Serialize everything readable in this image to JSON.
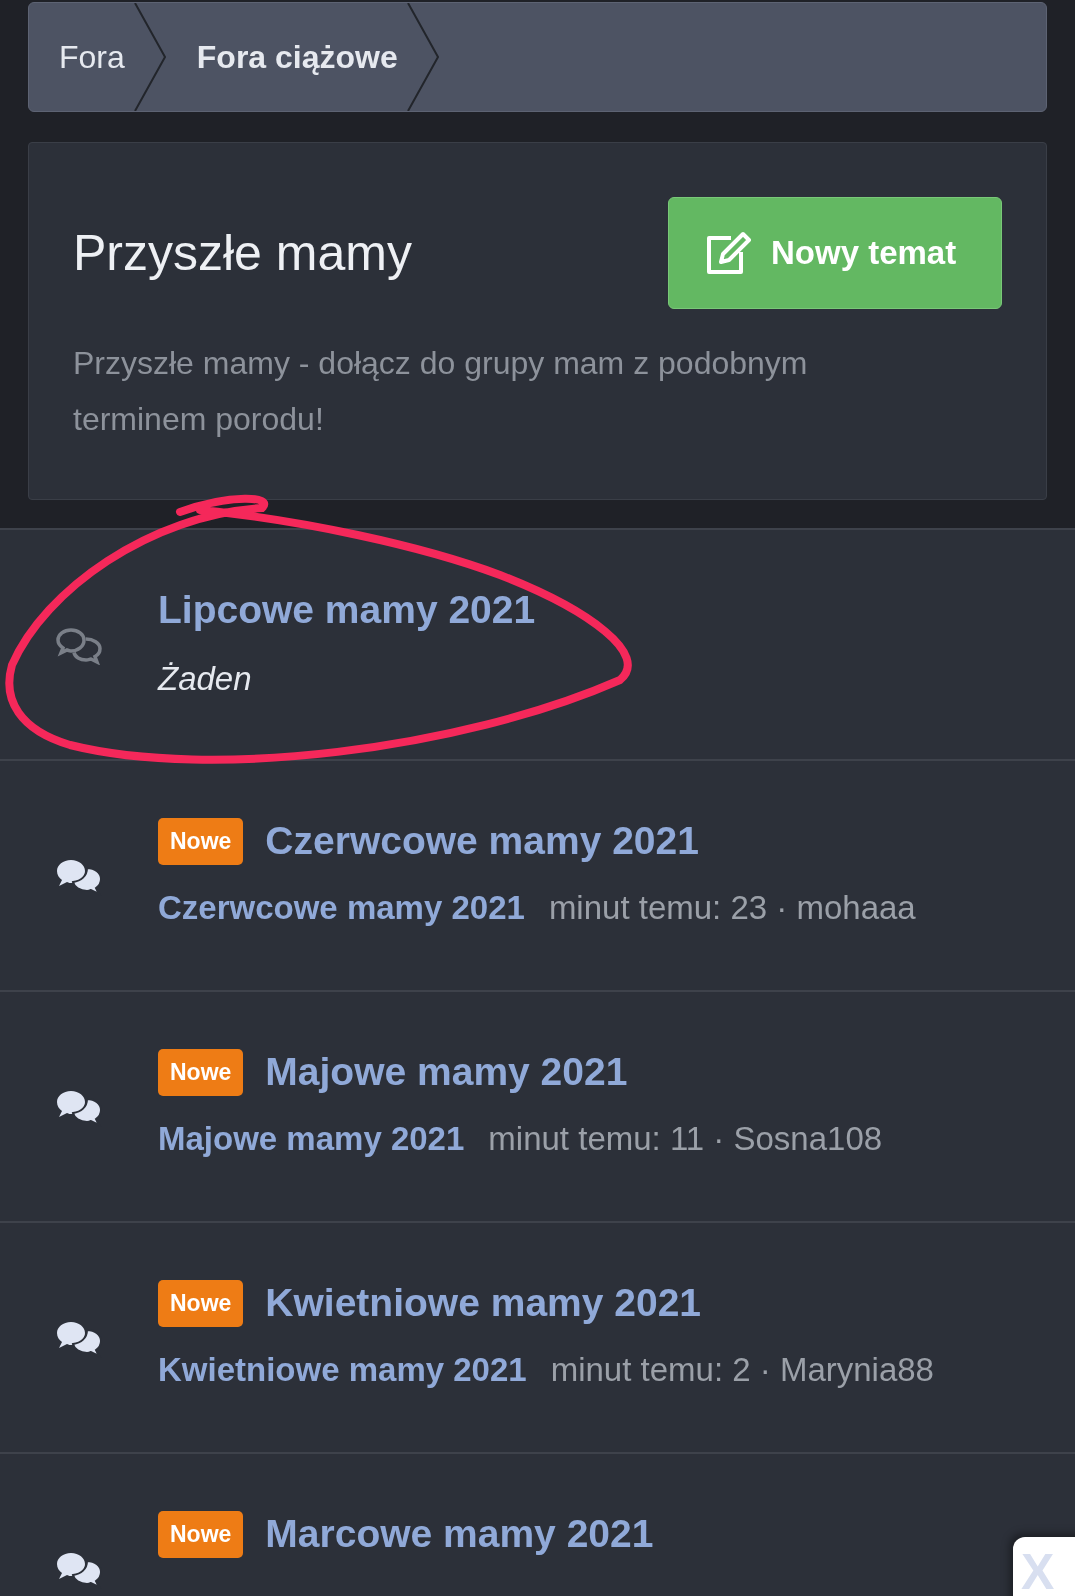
{
  "breadcrumbs": [
    {
      "label": "Fora",
      "selected": false
    },
    {
      "label": "Fora ciążowe",
      "selected": true
    }
  ],
  "header": {
    "title": "Przyszłe mamy",
    "button": "Nowy temat",
    "description": "Przyszłe mamy - dołącz do grupy mam z podobnym terminem porodu!"
  },
  "forums": [
    {
      "title": "Lipcowe mamy 2021",
      "unread": false,
      "kind": "empty",
      "latest": "Żaden"
    },
    {
      "title": "Czerwcowe mamy 2021",
      "unread": true,
      "badge": "Nowe",
      "kind": "latest",
      "latest": "Czerwcowe mamy 2021",
      "meta": "minut temu: 23 · mohaaa"
    },
    {
      "title": "Majowe mamy 2021",
      "unread": true,
      "badge": "Nowe",
      "kind": "latest",
      "latest": "Majowe mamy 2021",
      "meta": "minut temu: 11 · Sosna108"
    },
    {
      "title": "Kwietniowe mamy 2021",
      "unread": true,
      "badge": "Nowe",
      "kind": "latest",
      "latest": "Kwietniowe mamy 2021",
      "meta": "minut temu: 2 · Marynia88"
    },
    {
      "title": "Marcowe mamy 2021",
      "unread": true,
      "badge": "Nowe",
      "kind": "cut"
    }
  ],
  "annotation": {
    "kind": "circle"
  },
  "close_button": "X"
}
